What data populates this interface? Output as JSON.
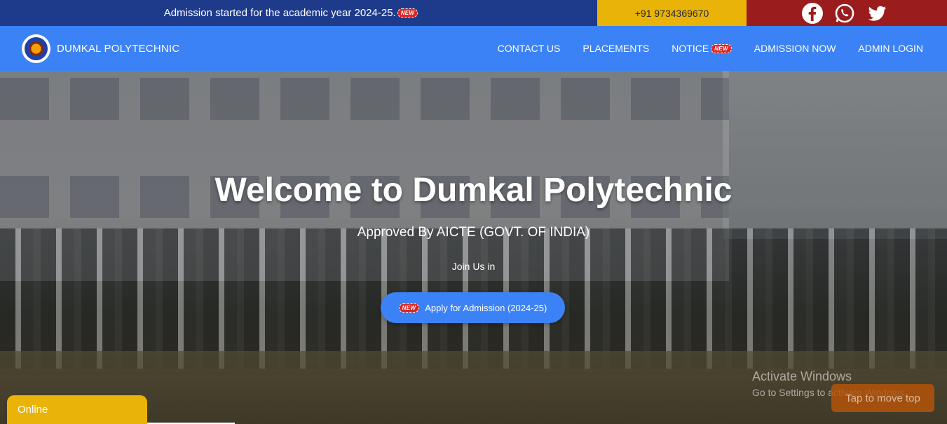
{
  "topbar": {
    "announcement": "Admission started for the academic year 2024-25.",
    "new_badge": "NEW",
    "phone": "+91 9734369670",
    "social": [
      "facebook-icon",
      "whatsapp-icon",
      "twitter-icon"
    ]
  },
  "navbar": {
    "brand": "DUMKAL POLYTECHNIC",
    "menu": [
      {
        "label": "CONTACT US"
      },
      {
        "label": "PLACEMENTS"
      },
      {
        "label": "NOTICE",
        "badge": "NEW"
      },
      {
        "label": "ADMISSION NOW"
      },
      {
        "label": "ADMIN LOGIN"
      }
    ]
  },
  "hero": {
    "title": "Welcome to Dumkal Polytechnic",
    "subtitle": "Approved By AICTE (GOVT. OF INDIA)",
    "join": "Join Us in",
    "apply_badge": "NEW",
    "apply_label": "Apply for Admission (2024-25)"
  },
  "watermark": {
    "line1": "Activate Windows",
    "line2": "Go to Settings to activate Windows."
  },
  "tap_top": "Tap to move top",
  "online": "Online",
  "colors": {
    "announce_bg": "#1e3a8a",
    "phone_bg": "#eab308",
    "social_bg": "#9b1c1c",
    "nav_bg": "#3b82f6",
    "button_bg": "#3b82f6"
  }
}
